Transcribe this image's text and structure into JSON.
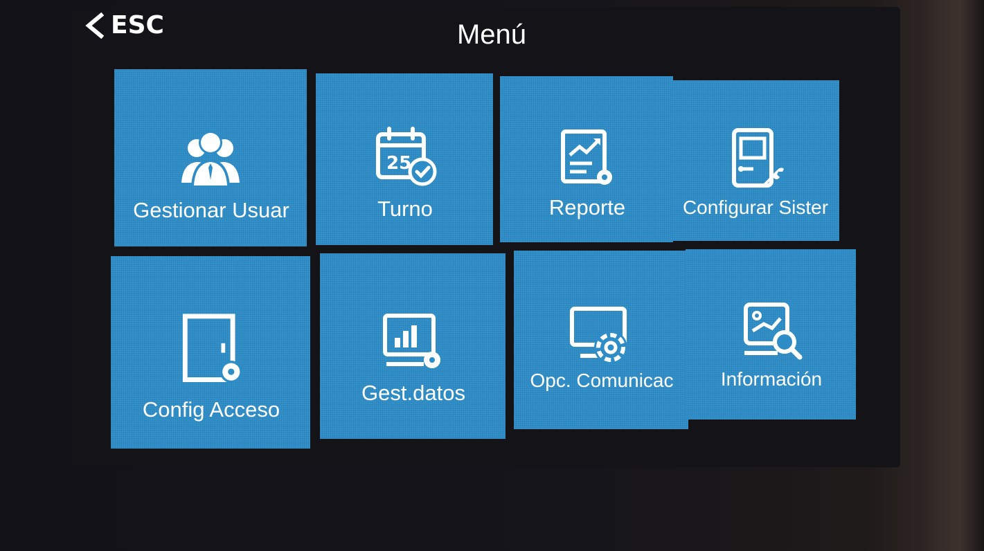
{
  "header": {
    "back_label": "ESC",
    "title": "Menú"
  },
  "tiles": [
    {
      "label": "Gestionar Usuar",
      "icon": "users-icon"
    },
    {
      "label": "Turno",
      "icon": "calendar-shift-icon"
    },
    {
      "label": "Reporte",
      "icon": "report-icon"
    },
    {
      "label": "Configurar Sister",
      "icon": "device-settings-icon"
    },
    {
      "label": "Config Acceso",
      "icon": "door-access-icon"
    },
    {
      "label": "Gest.datos",
      "icon": "data-management-icon"
    },
    {
      "label": "Opc. Comunicac",
      "icon": "communication-settings-icon"
    },
    {
      "label": "Información",
      "icon": "info-search-icon"
    }
  ],
  "colors": {
    "tile_blue": "#2e8dc7",
    "screen_black": "#141418",
    "text": "#ffffff"
  }
}
